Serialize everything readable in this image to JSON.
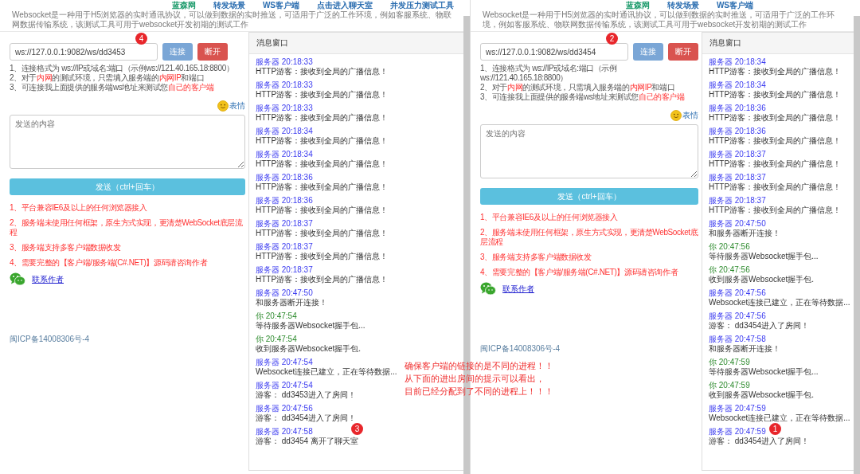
{
  "windows": [
    {
      "nav": [
        {
          "label": "蓝森网",
          "color": "#1a9a6a"
        },
        {
          "label": "转发场景",
          "color": "#2a6db0"
        },
        {
          "label": "WS客户端",
          "color": "#2a6db0"
        },
        {
          "label": "点击进入聊天室",
          "color": "#2a6db0"
        },
        {
          "label": "并发压力测试工具",
          "color": "#2a6db0"
        }
      ],
      "description": "Websocket是一种用于H5浏览器的实时通讯协议，可以做到数据的实时推送，可适用于广泛的工作环境，例如客服系统、物联网数据传输系统，该测试工具可用于websocket开发初期的测试工作",
      "url": {
        "value": "ws://127.0.0.1:9082/ws/dd3453",
        "badge": "4"
      },
      "connect_button": "连接",
      "disconnect_button": "断开",
      "hints": [
        "1、连接格式为 ws://IP或域名:端口（示例ws://121.40.165.18:8800）",
        "2、对于**内网**的测试环境，只需填入服务端的**内网IP**和端口",
        "3、可连接我上面提供的服务端ws地址来测试您**自己的客户端**"
      ],
      "emoji_link": "表情",
      "message_input": {
        "placeholder": "发送的内容"
      },
      "send_button": "发送（ctrl+回车）",
      "features": [
        "1、平台兼容IE6及以上的任何浏览器接入",
        "2、服务端未使用任何框架，原生方式实现，更清楚WebSocket底层流程",
        "3、服务端支持多客户端数据收发",
        "4、需要完整的【客户端/服务端(C#.NET)】源码请咨询作者"
      ],
      "contact_link": "联系作者",
      "icp": "闽ICP备14008306号-4",
      "message_panel": {
        "title": "消息窗口",
        "messages": [
          {
            "kind": "server",
            "sender": "服务器",
            "time": "20:18:33",
            "text": "HTTP游客：接收到全局的广播信息！"
          },
          {
            "kind": "server",
            "sender": "服务器",
            "time": "20:18:33",
            "text": "HTTP游客：接收到全局的广播信息！"
          },
          {
            "kind": "server",
            "sender": "服务器",
            "time": "20:18:33",
            "text": "HTTP游客：接收到全局的广播信息！"
          },
          {
            "kind": "server",
            "sender": "服务器",
            "time": "20:18:34",
            "text": "HTTP游客：接收到全局的广播信息！"
          },
          {
            "kind": "server",
            "sender": "服务器",
            "time": "20:18:34",
            "text": "HTTP游客：接收到全局的广播信息！"
          },
          {
            "kind": "server",
            "sender": "服务器",
            "time": "20:18:36",
            "text": "HTTP游客：接收到全局的广播信息！"
          },
          {
            "kind": "server",
            "sender": "服务器",
            "time": "20:18:36",
            "text": "HTTP游客：接收到全局的广播信息！"
          },
          {
            "kind": "server",
            "sender": "服务器",
            "time": "20:18:37",
            "text": "HTTP游客：接收到全局的广播信息！"
          },
          {
            "kind": "server",
            "sender": "服务器",
            "time": "20:18:37",
            "text": "HTTP游客：接收到全局的广播信息！"
          },
          {
            "kind": "server",
            "sender": "服务器",
            "time": "20:18:37",
            "text": "HTTP游客：接收到全局的广播信息！"
          },
          {
            "kind": "server",
            "sender": "服务器",
            "time": "20:47:50",
            "text": "和服务器断开连接！"
          },
          {
            "kind": "self",
            "sender": "你",
            "time": "20:47:54",
            "text": "等待服务器Websocket握手包..."
          },
          {
            "kind": "self",
            "sender": "你",
            "time": "20:47:54",
            "text": "收到服务器Websocket握手包."
          },
          {
            "kind": "server",
            "sender": "服务器",
            "time": "20:47:54",
            "text": "Websocket连接已建立，正在等待数据..."
          },
          {
            "kind": "server",
            "sender": "服务器",
            "time": "20:47:54",
            "text": "游客： dd3453进入了房间！"
          },
          {
            "kind": "server",
            "sender": "服务器",
            "time": "20:47:56",
            "text": "游客： dd3454进入了房间！"
          },
          {
            "kind": "server",
            "sender": "服务器",
            "time": "20:47:58",
            "text": "游客： dd3454 离开了聊天室",
            "badge": "3"
          }
        ]
      }
    },
    {
      "nav": [
        {
          "label": "蓝森网",
          "color": "#1a9a6a"
        },
        {
          "label": "转发场景",
          "color": "#2a6db0"
        },
        {
          "label": "WS客户端",
          "color": "#2a6db0"
        }
      ],
      "description": "Websocket是一种用于H5浏览器的实时通讯协议，可以做到数据的实时推送，可适用于广泛的工作环境，例如客服系统、物联网数据传输系统，该测试工具可用于websocket开发初期的测试工作",
      "url": {
        "value": "ws://127.0.0.1:9082/ws/dd3454",
        "badge": "2"
      },
      "connect_button": "连接",
      "disconnect_button": "断开",
      "hints": [
        "1、连接格式为 ws://IP或域名:端口（示例ws://121.40.165.18:8800）",
        "2、对于**内网**的测试环境，只需填入服务端的**内网IP**和端口",
        "3、可连接我上面提供的服务端ws地址来测试您**自己的客户端**"
      ],
      "emoji_link": "表情",
      "message_input": {
        "placeholder": "发送的内容"
      },
      "send_button": "发送（ctrl+回车）",
      "features": [
        "1、平台兼容IE6及以上的任何浏览器接入",
        "2、服务端未使用任何框架，原生方式实现，更清楚WebSocket底层流程",
        "3、服务端支持多客户端数据收发",
        "4、需要完整的【客户端/服务端(C#.NET)】源码请咨询作者"
      ],
      "contact_link": "联系作者",
      "icp": "闽ICP备14008306号-4",
      "message_panel": {
        "title": "消息窗口",
        "messages": [
          {
            "kind": "server",
            "sender": "服务器",
            "time": "20:18:34",
            "text": "HTTP游客：接收到全局的广播信息！"
          },
          {
            "kind": "server",
            "sender": "服务器",
            "time": "20:18:34",
            "text": "HTTP游客：接收到全局的广播信息！"
          },
          {
            "kind": "server",
            "sender": "服务器",
            "time": "20:18:36",
            "text": "HTTP游客：接收到全局的广播信息！"
          },
          {
            "kind": "server",
            "sender": "服务器",
            "time": "20:18:36",
            "text": "HTTP游客：接收到全局的广播信息！"
          },
          {
            "kind": "server",
            "sender": "服务器",
            "time": "20:18:37",
            "text": "HTTP游客：接收到全局的广播信息！"
          },
          {
            "kind": "server",
            "sender": "服务器",
            "time": "20:18:37",
            "text": "HTTP游客：接收到全局的广播信息！"
          },
          {
            "kind": "server",
            "sender": "服务器",
            "time": "20:18:37",
            "text": "HTTP游客：接收到全局的广播信息！"
          },
          {
            "kind": "server",
            "sender": "服务器",
            "time": "20:47:50",
            "text": "和服务器断开连接！"
          },
          {
            "kind": "self",
            "sender": "你",
            "time": "20:47:56",
            "text": "等待服务器Websocket握手包..."
          },
          {
            "kind": "self",
            "sender": "你",
            "time": "20:47:56",
            "text": "收到服务器Websocket握手包."
          },
          {
            "kind": "server",
            "sender": "服务器",
            "time": "20:47:56",
            "text": "Websocket连接已建立，正在等待数据..."
          },
          {
            "kind": "server",
            "sender": "服务器",
            "time": "20:47:56",
            "text": "游客： dd3454进入了房间！"
          },
          {
            "kind": "server",
            "sender": "服务器",
            "time": "20:47:58",
            "text": "和服务器断开连接！"
          },
          {
            "kind": "self",
            "sender": "你",
            "time": "20:47:59",
            "text": "等待服务器Websocket握手包..."
          },
          {
            "kind": "self",
            "sender": "你",
            "time": "20:47:59",
            "text": "收到服务器Websocket握手包."
          },
          {
            "kind": "server",
            "sender": "服务器",
            "time": "20:47:59",
            "text": "Websocket连接已建立，正在等待数据..."
          },
          {
            "kind": "server",
            "sender": "服务器",
            "time": "20:47:59",
            "text": "游客： dd3454进入了房间！",
            "badge": "1"
          }
        ]
      }
    }
  ],
  "annotation": [
    "确保客户端的链接的是不同的进程！！",
    "从下面的进出房间的提示可以看出，",
    "目前已经分配到了不同的进程上！！！"
  ]
}
